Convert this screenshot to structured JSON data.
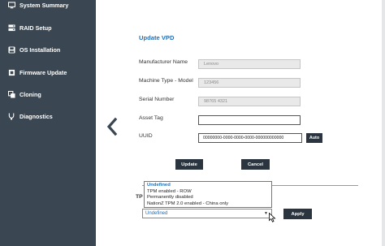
{
  "sidebar": {
    "items": [
      {
        "label": "System Summary",
        "icon": "monitor-icon"
      },
      {
        "label": "RAID Setup",
        "icon": "raid-icon"
      },
      {
        "label": "OS Installation",
        "icon": "disk-icon"
      },
      {
        "label": "Firmware Update",
        "icon": "chip-icon"
      },
      {
        "label": "Cloning",
        "icon": "clone-icon"
      },
      {
        "label": "Diagnostics",
        "icon": "stethoscope-icon"
      }
    ],
    "background": "#3a4651"
  },
  "form": {
    "title": "Update VPD",
    "fields": [
      {
        "label": "Manufacturer Name",
        "value": "Lenovo"
      },
      {
        "label": "Machine Type - Model",
        "value": "123456"
      },
      {
        "label": "Serial Number",
        "value": "98765 4321"
      },
      {
        "label": "Asset Tag",
        "value": ""
      },
      {
        "label": "UUID",
        "value": "00000000-0000-0000-0000-000000000000"
      }
    ],
    "auto_label": "Auto",
    "update_label": "Update",
    "cancel_label": "Cancel"
  },
  "tpm": {
    "label": "TP",
    "options": [
      "Undefined",
      "TPM enabled - ROW",
      "Permanently disabled",
      "NationZ TPM 2.0 enabled - China only"
    ],
    "selected": "Undefined",
    "apply_label": "Apply"
  },
  "colors": {
    "accent": "#1f6fb5",
    "button": "#2a3540"
  }
}
